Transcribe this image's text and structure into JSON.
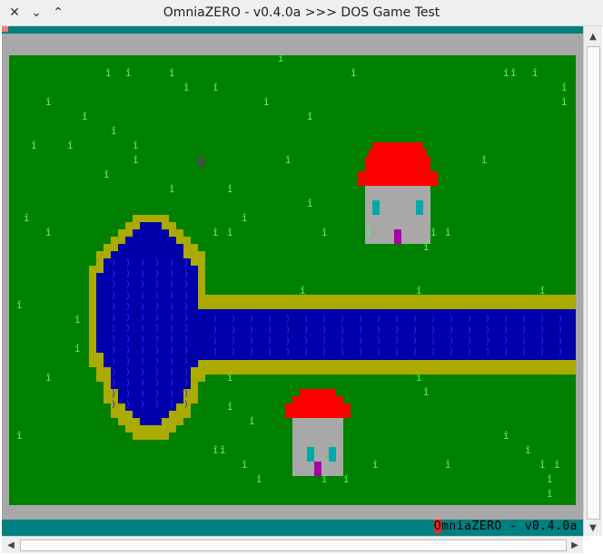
{
  "window": {
    "title": "OmniaZERO - v0.4.0a >>> DOS Game Test",
    "buttons": [
      "close",
      "minimize",
      "maximize"
    ]
  },
  "game": {
    "status_first": "O",
    "status_rest": "mniaZERO - v0.4.0a",
    "player_glyph": "@",
    "grass_glyph": "î",
    "colors": {
      "background": "#008080",
      "grass": "#008000",
      "grass_glyph": "#55ff55",
      "water": "#0000aa",
      "water_glyph": "#2a2aff",
      "sand": "#aaaa00",
      "wall": "#a8a8a8",
      "roof": "#ff0000",
      "window": "#00aaaa",
      "door": "#aa00aa",
      "border": "#a8a8a8"
    }
  }
}
